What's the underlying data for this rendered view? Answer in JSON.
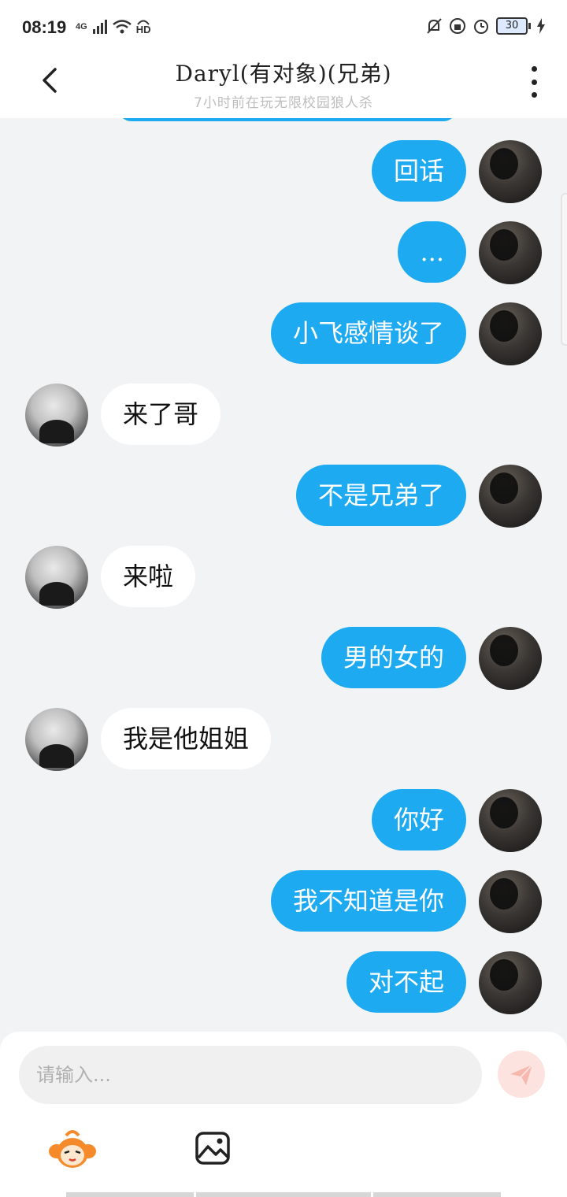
{
  "status_bar": {
    "time": "08:19",
    "network": "4G",
    "hd": "HD",
    "battery": "30"
  },
  "header": {
    "title": "Daryl(有对象)(兄弟)",
    "subtitle": "7小时前在玩无限校园狼人杀"
  },
  "messages": [
    {
      "side": "me",
      "text": "回话"
    },
    {
      "side": "me",
      "text": "..."
    },
    {
      "side": "me",
      "text": "小飞感情谈了"
    },
    {
      "side": "them",
      "text": "来了哥"
    },
    {
      "side": "me",
      "text": "不是兄弟了"
    },
    {
      "side": "them",
      "text": "来啦"
    },
    {
      "side": "me",
      "text": "男的女的"
    },
    {
      "side": "them",
      "text": "我是他姐姐"
    },
    {
      "side": "me",
      "text": "你好"
    },
    {
      "side": "me",
      "text": "我不知道是你"
    },
    {
      "side": "me",
      "text": "对不起"
    }
  ],
  "composer": {
    "placeholder": "请输入..."
  },
  "colors": {
    "my_bubble": "#1eaaf1",
    "their_bubble": "#ffffff",
    "background": "#f2f3f5",
    "send_button": "#fde3df"
  }
}
